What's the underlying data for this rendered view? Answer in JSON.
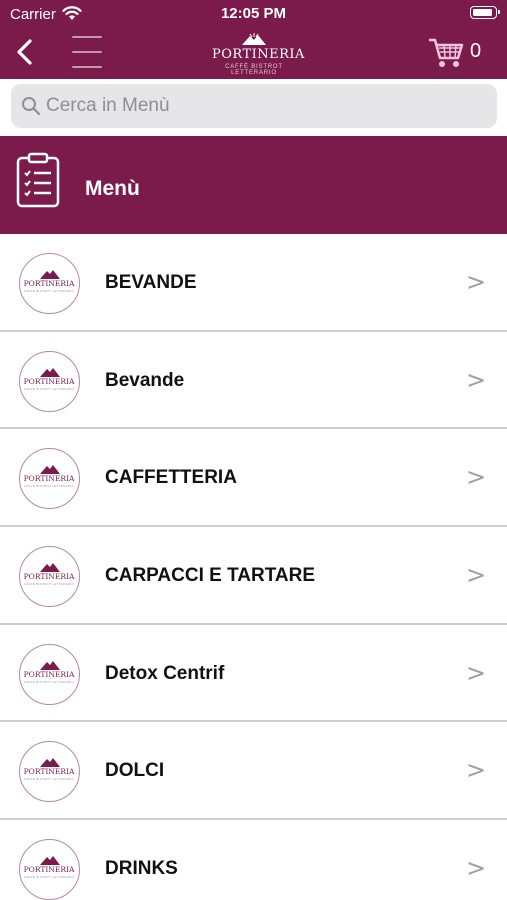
{
  "status": {
    "carrier": "Carrier",
    "time": "12:05 PM"
  },
  "nav": {
    "logo_text": "PORTINERIA",
    "logo_sub": "CAFFÈ BISTROT LETTERARIO",
    "cart_count": "0"
  },
  "search": {
    "placeholder": "Cerca in Menù"
  },
  "section": {
    "title": "Menù"
  },
  "colors": {
    "brand": "#7a1b4b"
  },
  "items": [
    {
      "label": "BEVANDE"
    },
    {
      "label": "Bevande"
    },
    {
      "label": "CAFFETTERIA"
    },
    {
      "label": "CARPACCI E TARTARE"
    },
    {
      "label": "Detox Centrif"
    },
    {
      "label": "DOLCI"
    },
    {
      "label": "DRINKS"
    }
  ]
}
